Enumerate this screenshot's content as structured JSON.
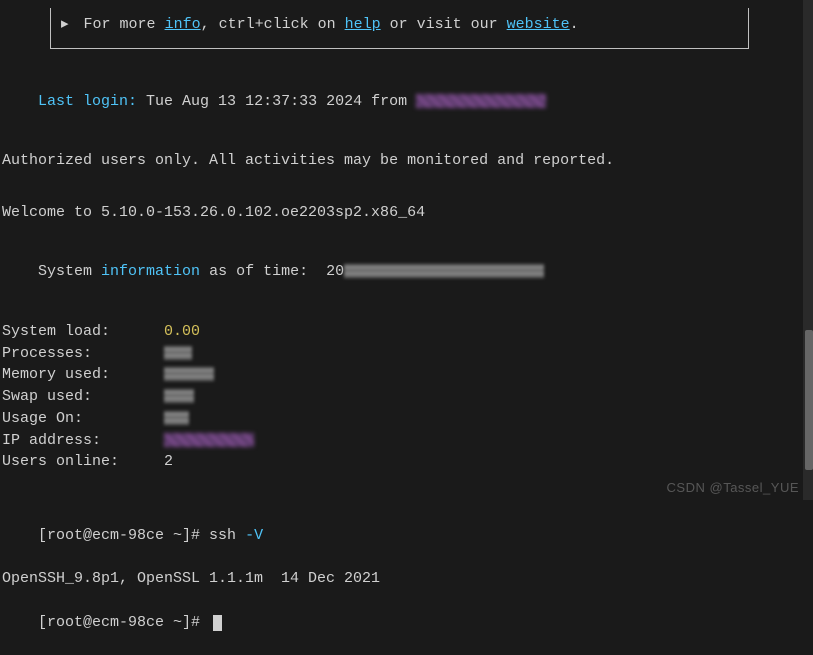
{
  "tip": {
    "bullet": "▸",
    "text_pre": "For more ",
    "info": "info",
    "text_mid": ", ctrl+click on ",
    "help": "help",
    "text_mid2": " or visit our ",
    "website": "website",
    "text_end": "."
  },
  "login": {
    "label": "Last login:",
    "value": " Tue Aug 13 12:37:33 2024 from "
  },
  "auth": "Authorized users only. All activities may be monitored and reported.",
  "welcome": "Welcome to 5.10.0-153.26.0.102.oe2203sp2.x86_64",
  "sysinfo": {
    "pre": "System ",
    "info_word": "information",
    "post": " as of time:  ",
    "time_prefix": "20"
  },
  "stats": {
    "load_label": "System load:",
    "load_value": "0.00",
    "processes_label": "Processes:",
    "memory_label": "Memory used:",
    "swap_label": "Swap used:",
    "usage_label": "Usage On:",
    "ip_label": "IP address:",
    "users_label": "Users online:",
    "users_value": "2"
  },
  "prompts": {
    "p1_user": "[root@ecm-98ce ~]# ",
    "p1_cmd": "ssh ",
    "p1_flag": "-V",
    "ssh_version": "OpenSSH_9.8p1, OpenSSL 1.1.1m  14 Dec 2021",
    "p2_user": "[root@ecm-98ce ~]# "
  },
  "watermark": "CSDN @Tassel_YUE"
}
